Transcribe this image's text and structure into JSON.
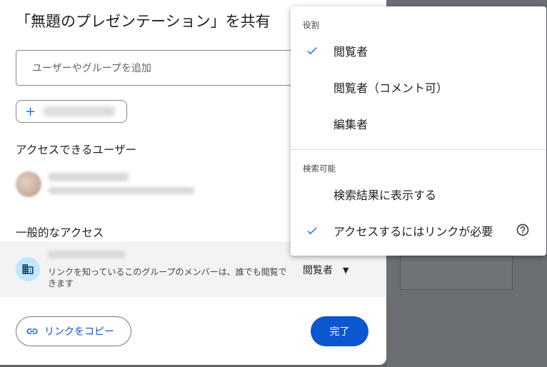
{
  "dialog": {
    "title": "「無題のプレゼンテーション」を共有",
    "add_input_placeholder": "ユーザーやグループを追加",
    "people_section": "アクセスできるユーザー",
    "general_section": "一般的なアクセス",
    "general_access": {
      "description": "リンクを知っているこのグループのメンバーは、誰でも閲覧できます",
      "role": "閲覧者"
    },
    "copy_link_label": "リンクをコピー",
    "done_label": "完了"
  },
  "menu": {
    "role_header": "役割",
    "roles": [
      {
        "label": "閲覧者",
        "checked": true
      },
      {
        "label": "閲覧者（コメント可）",
        "checked": false
      },
      {
        "label": "編集者",
        "checked": false
      }
    ],
    "visibility_header": "検索可能",
    "visibility": [
      {
        "label": "検索結果に表示する",
        "checked": false
      },
      {
        "label": "アクセスするにはリンクが必要",
        "checked": true,
        "has_help": true
      }
    ]
  },
  "colors": {
    "accent": "#0b57d0",
    "check": "#1a73e8",
    "access_row_bg": "#f1f3f4",
    "icon_bg": "#c2e7ff"
  }
}
